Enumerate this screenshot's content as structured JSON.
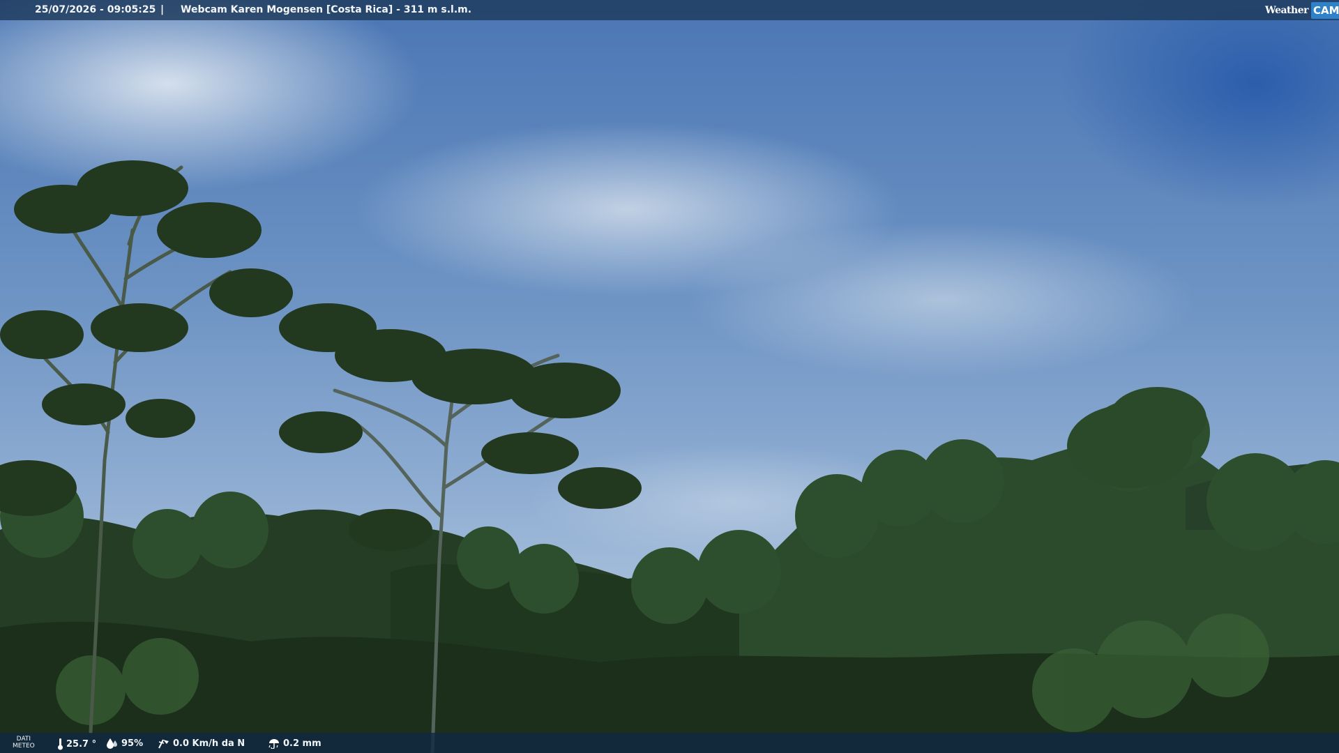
{
  "overlay_top": {
    "timestamp": "25/07/2026 - 09:05:25",
    "separator": "|",
    "location": "Webcam Karen Mogensen [Costa Rica]  - 311 m s.l.m."
  },
  "logo": {
    "word_left": "Weather",
    "word_right": "CAM"
  },
  "overlay_bottom": {
    "label_line1": "DATI",
    "label_line2": "METEO",
    "temperature": "25.7 °",
    "humidity": "95%",
    "wind": "0.0 Km/h da N",
    "rain": "0.2 mm"
  },
  "colors": {
    "bar_top": "#1e3a5c",
    "bar_bottom": "#0e2842",
    "logo_accent": "#2f82c9"
  },
  "icons": [
    "thermometer-icon",
    "humidity-drop-icon",
    "wind-icon",
    "rain-icon"
  ]
}
